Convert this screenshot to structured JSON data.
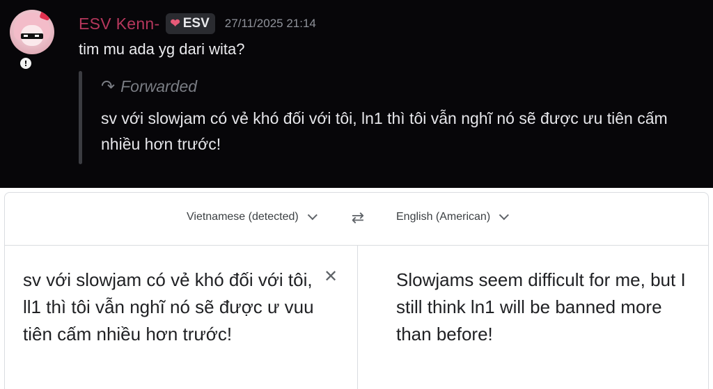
{
  "message": {
    "author": "ESV Kenn-",
    "tag": "ESV",
    "tag_icon": "heart-icon",
    "timestamp": "27/11/2025 21:14",
    "text": "tim mu ada yg dari wita?",
    "status_icon": "exclamation-badge-icon",
    "forwarded": {
      "label": "Forwarded",
      "text": "sv với slowjam có vẻ khó đối với tôi, ln1 thì tôi vẫn nghĩ nó sẽ được ưu tiên cấm nhiều hơn trước!"
    },
    "colors": {
      "author": "#b6375c",
      "background": "#070609"
    }
  },
  "translate": {
    "source_language": "Vietnamese (detected)",
    "target_language": "English (American)",
    "source_text": "sv với slowjam có vẻ khó đối với tôi, ll1 thì tôi vẫn nghĩ nó sẽ được ư vuu tiên cấm nhiều hơn trước!",
    "translated_text": "Slowjams seem difficult for me, but I still think ln1 will be banned more than before!"
  }
}
